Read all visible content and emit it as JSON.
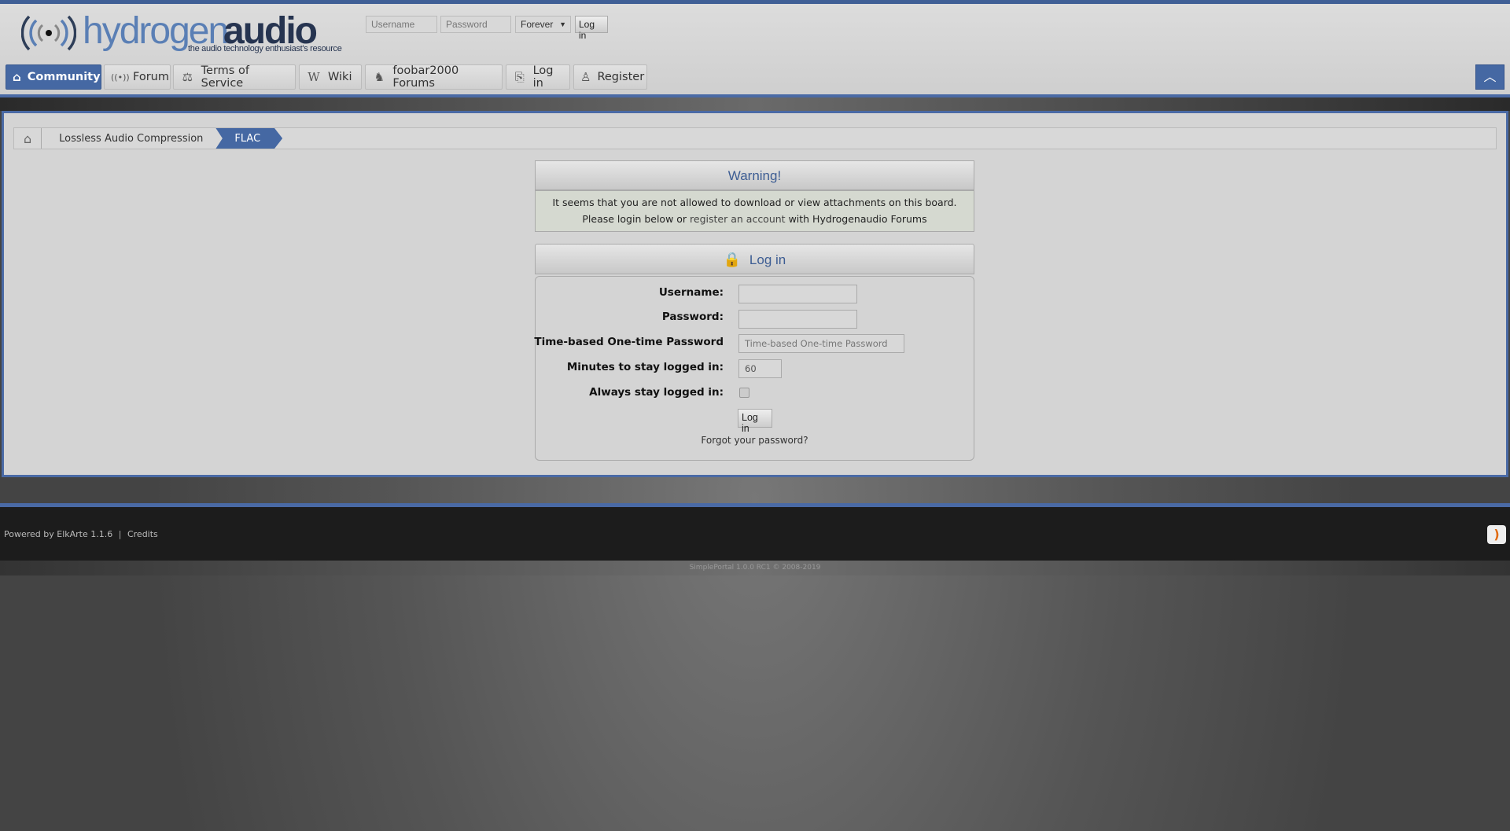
{
  "header": {
    "logo_light": "hydrogen",
    "logo_bold": "audio",
    "tagline": "the audio technology enthusiast's resource",
    "username_placeholder": "Username",
    "password_placeholder": "Password",
    "duration": "Forever",
    "login": "Log in"
  },
  "nav": [
    {
      "label": "Community",
      "icon": "home-icon"
    },
    {
      "label": "Forum",
      "icon": "broadcast-icon"
    },
    {
      "label": "Terms of Service",
      "icon": "scales-icon"
    },
    {
      "label": "Wiki",
      "icon": "wikipedia-icon"
    },
    {
      "label": "foobar2000 Forums",
      "icon": "fox-icon"
    },
    {
      "label": "Log in",
      "icon": "door-icon"
    },
    {
      "label": "Register",
      "icon": "add-user-icon"
    }
  ],
  "breadcrumb": [
    "Lossless Audio Compression",
    "FLAC"
  ],
  "warning": {
    "title": "Warning!",
    "line1": "It seems that you are not allowed to download or view attachments on this board.",
    "line2_pre": "Please login below or ",
    "line2_link": "register an account",
    "line2_post": " with Hydrogenaudio Forums"
  },
  "login": {
    "title": "Log in",
    "username_label": "Username:",
    "password_label": "Password:",
    "totp_label": "Time-based One-time Password",
    "totp_placeholder": "Time-based One-time Password",
    "minutes_label": "Minutes to stay logged in:",
    "minutes_value": "60",
    "always_label": "Always stay logged in:",
    "always_checked": false,
    "button": "Log in",
    "forgot": "Forgot your password?"
  },
  "footer": {
    "powered": "Powered by ElkArte 1.1.6",
    "credits": "Credits",
    "simpleportal": "SimplePortal 1.0.0 RC1 © 2008-2019"
  },
  "colors": {
    "accent": "#4568a3",
    "footer": "#1c1c1c"
  }
}
